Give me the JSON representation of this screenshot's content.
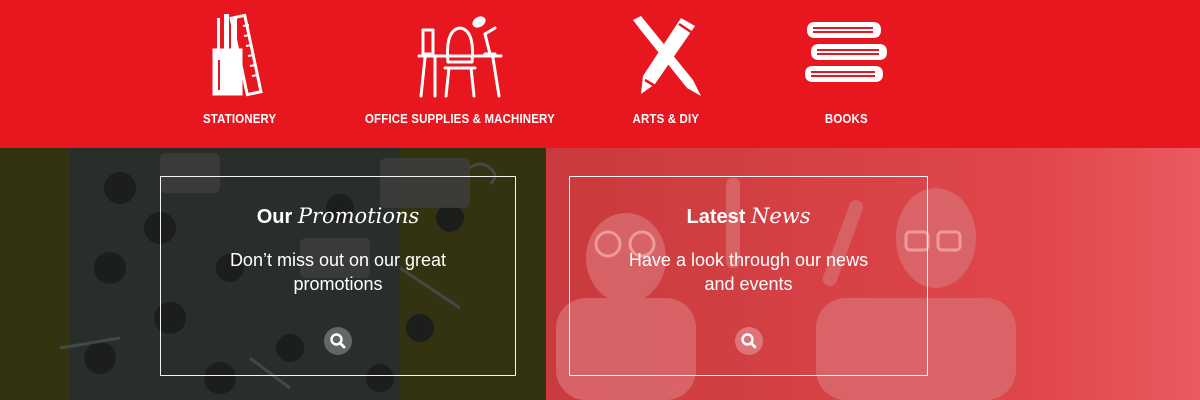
{
  "categories": [
    {
      "label": "STATIONERY",
      "icon": "stationery-icon"
    },
    {
      "label": "OFFICE SUPPLIES & MACHINERY",
      "icon": "office-desk-icon"
    },
    {
      "label": "ARTS & DIY",
      "icon": "arts-diy-icon"
    },
    {
      "label": "BOOKS",
      "icon": "books-icon"
    }
  ],
  "promotions": {
    "title_plain": "Our",
    "title_script": "Promotions",
    "description": "Don’t miss out on our great promotions",
    "button_icon": "search-icon"
  },
  "news": {
    "title_plain": "Latest",
    "title_script": "News",
    "description": "Have a look through our news and events",
    "button_icon": "search-icon"
  },
  "colors": {
    "brand_red": "#e8161f",
    "text": "#ffffff",
    "left_overlay": "#3a3a10",
    "right_overlay": "#e84a4f"
  }
}
